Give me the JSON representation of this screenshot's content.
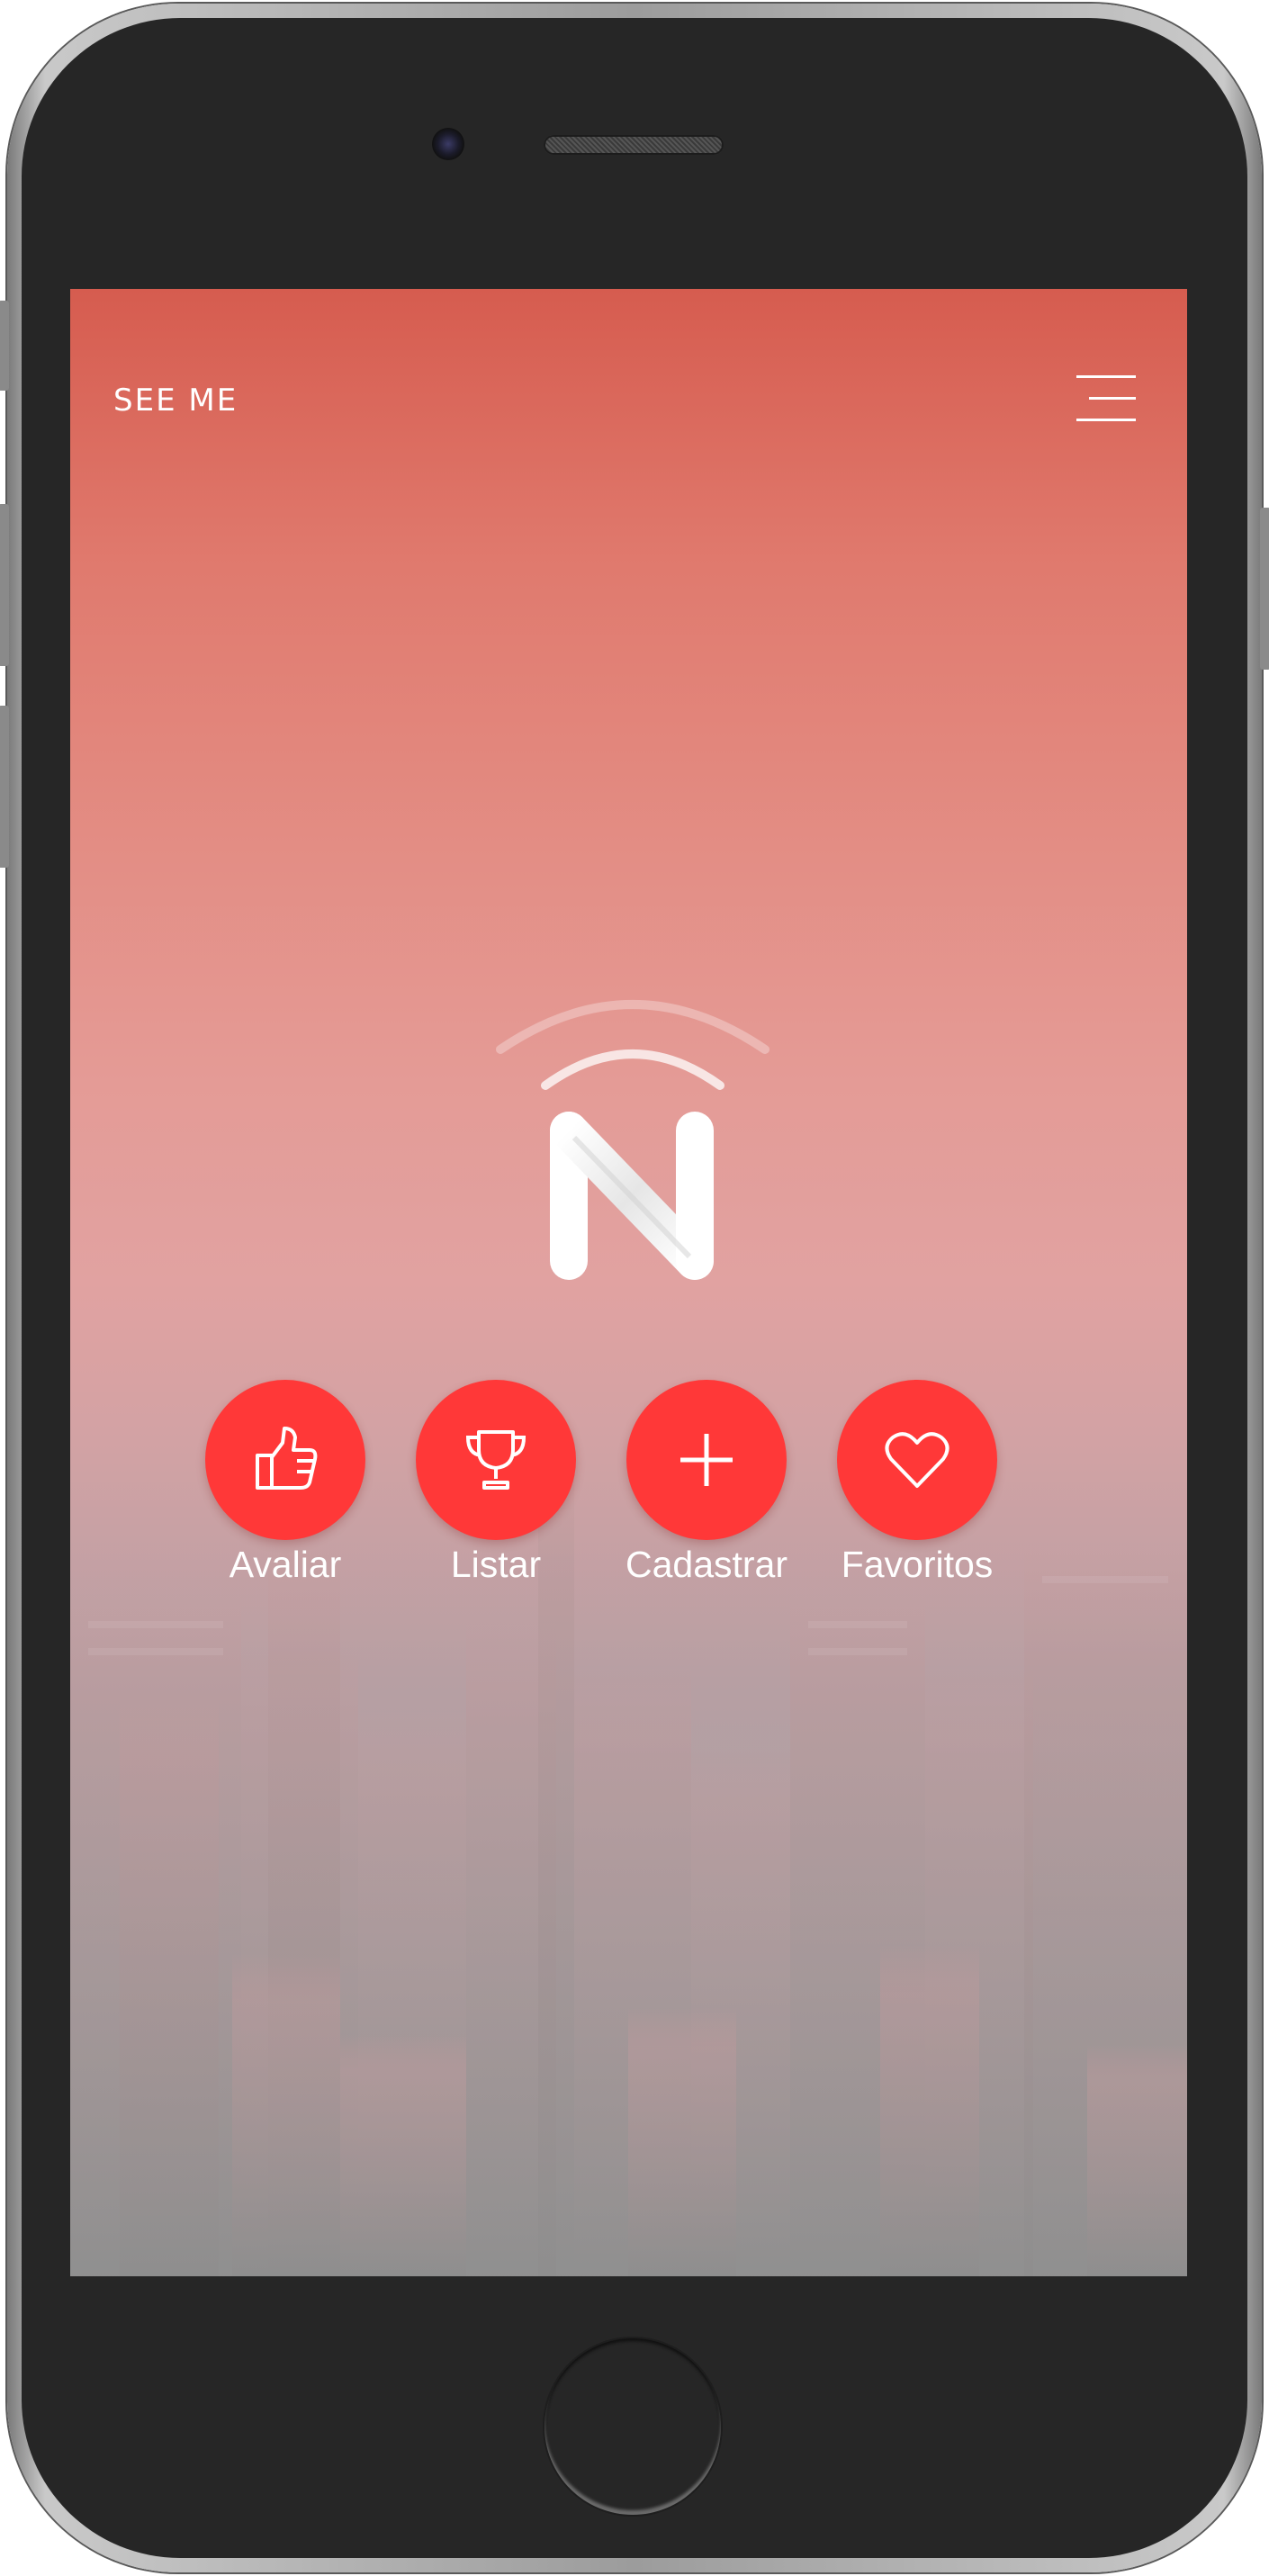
{
  "app": {
    "title": "SEE ME"
  },
  "header": {
    "menu_icon": "hamburger-menu-icon"
  },
  "logo": {
    "icon": "n-signal-logo-icon"
  },
  "actions": [
    {
      "label": "Avaliar",
      "icon": "thumbs-up-icon"
    },
    {
      "label": "Listar",
      "icon": "trophy-icon"
    },
    {
      "label": "Cadastrar",
      "icon": "plus-icon"
    },
    {
      "label": "Favoritos",
      "icon": "heart-icon"
    }
  ],
  "colors": {
    "accent": "#ff3838",
    "header_gradient_top": "#d65c4f",
    "text": "#ffffff"
  }
}
